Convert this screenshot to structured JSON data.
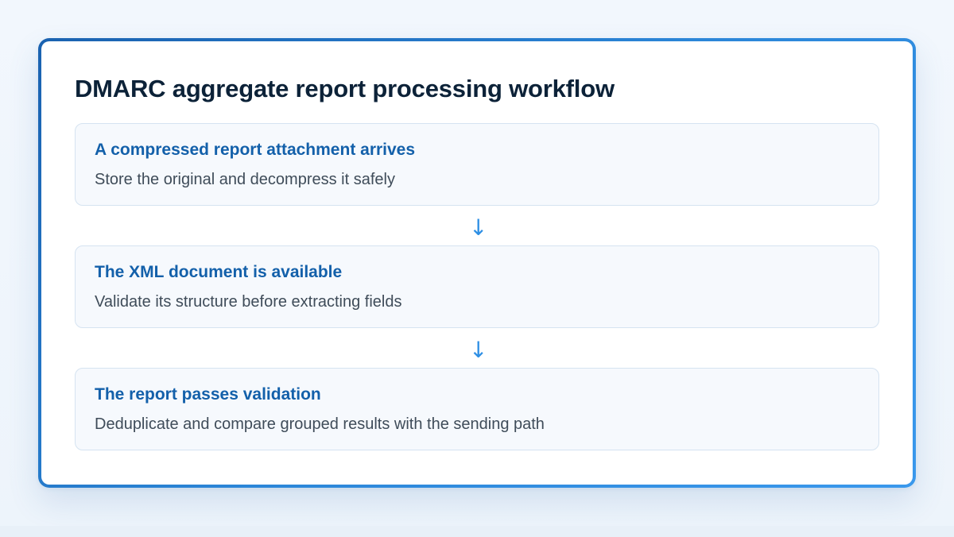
{
  "workflow": {
    "title": "DMARC aggregate report processing workflow",
    "steps": [
      {
        "title": "A compressed report attachment arrives",
        "description": "Store the original and decompress it safely"
      },
      {
        "title": "The XML document is available",
        "description": "Validate its structure before extracting fields"
      },
      {
        "title": "The report passes validation",
        "description": "Deduplicate and compare grouped results with the sending path"
      }
    ],
    "arrow_icon": "arrow-down-icon",
    "colors": {
      "accent": "#2e8fe4",
      "border_gradient_start": "#1a62b0",
      "border_gradient_end": "#3a98ec",
      "step_title": "#1360aa",
      "title": "#0c2238",
      "description": "#3f4c59",
      "step_background": "#f6f9fd",
      "step_border": "#d5e3f1"
    }
  }
}
